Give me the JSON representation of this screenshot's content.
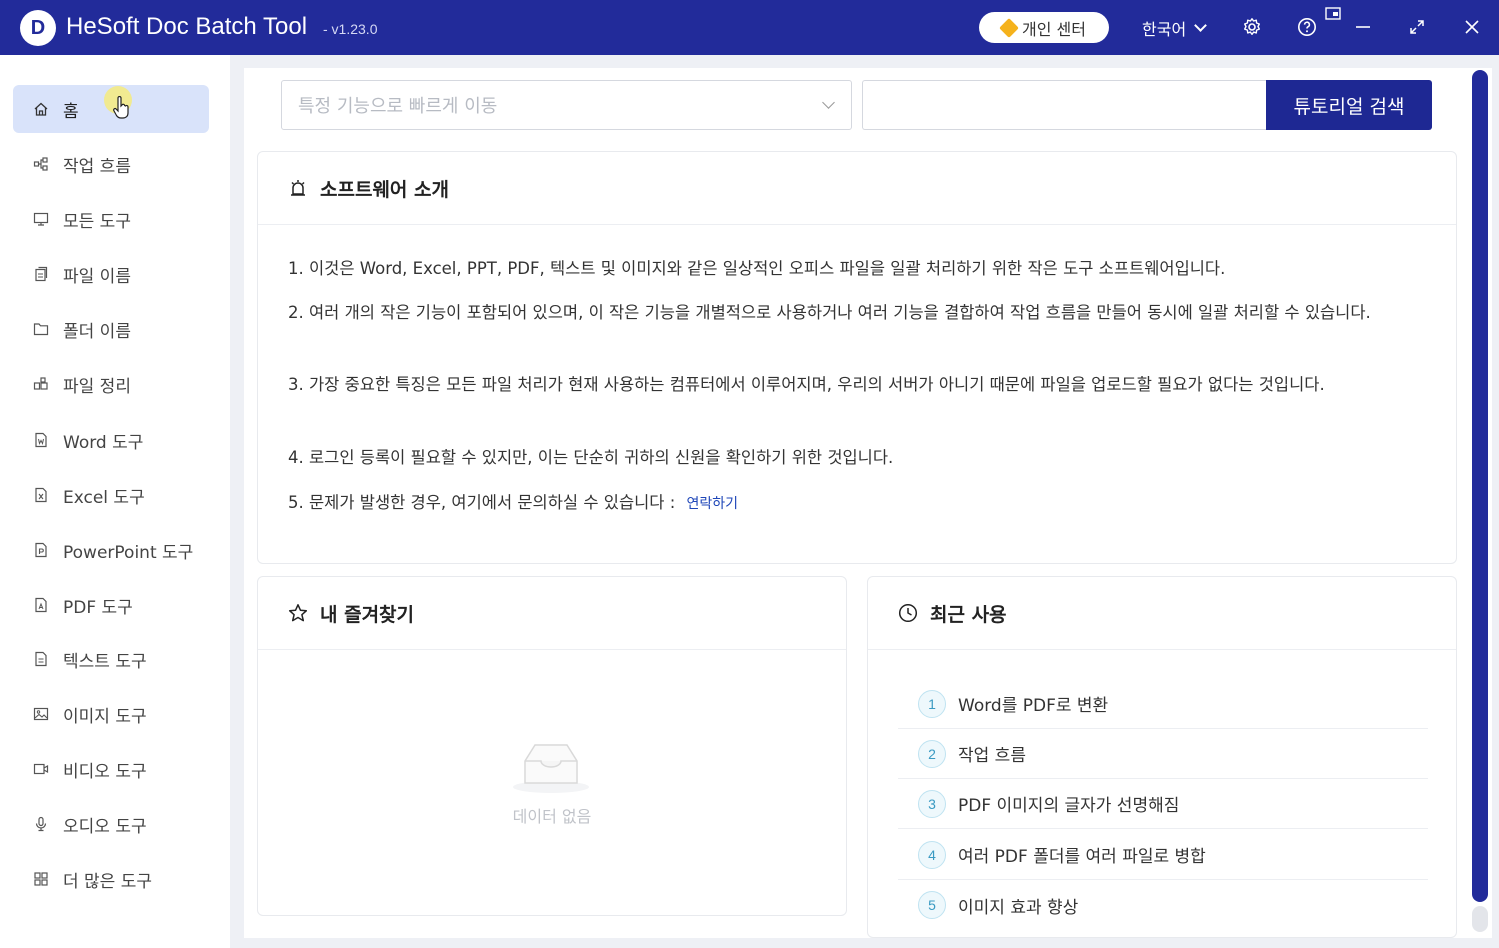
{
  "app": {
    "title": "HeSoft Doc Batch Tool",
    "version": "- v1.23.0",
    "logo_letter": "D"
  },
  "titlebar": {
    "personal_center": "개인 센터",
    "language": "한국어"
  },
  "sidebar": {
    "items": [
      {
        "label": "홈",
        "icon": "home-icon",
        "active": true
      },
      {
        "label": "작업 흐름",
        "icon": "workflow-icon"
      },
      {
        "label": "모든 도구",
        "icon": "monitor-icon"
      },
      {
        "label": "파일 이름",
        "icon": "file-copy-icon"
      },
      {
        "label": "폴더 이름",
        "icon": "folder-icon"
      },
      {
        "label": "파일 정리",
        "icon": "organize-icon"
      },
      {
        "label": "Word 도구",
        "icon": "word-icon"
      },
      {
        "label": "Excel 도구",
        "icon": "excel-icon"
      },
      {
        "label": "PowerPoint 도구",
        "icon": "powerpoint-icon"
      },
      {
        "label": "PDF 도구",
        "icon": "pdf-icon"
      },
      {
        "label": "텍스트 도구",
        "icon": "text-icon"
      },
      {
        "label": "이미지 도구",
        "icon": "image-icon"
      },
      {
        "label": "비디오 도구",
        "icon": "video-icon"
      },
      {
        "label": "오디오 도구",
        "icon": "audio-icon"
      },
      {
        "label": "더 많은 도구",
        "icon": "grid-icon"
      }
    ]
  },
  "search": {
    "select_placeholder": "특정 기능으로 빠르게 이동",
    "input_value": "",
    "button_label": "튜토리얼 검색"
  },
  "intro": {
    "title": "소프트웨어 소개",
    "lines": [
      "1. 이것은 Word, Excel, PPT, PDF, 텍스트 및 이미지와 같은 일상적인 오피스 파일을 일괄 처리하기 위한 작은 도구 소프트웨어입니다.",
      "2. 여러 개의 작은 기능이 포함되어 있으며, 이 작은 기능을 개별적으로 사용하거나 여러 기능을 결합하여 작업 흐름을 만들어 동시에 일괄 처리할 수 있습니다.",
      "3. 가장 중요한 특징은 모든 파일 처리가 현재 사용하는 컴퓨터에서 이루어지며, 우리의 서버가 아니기 때문에 파일을 업로드할 필요가 없다는 것입니다.",
      "4. 로그인 등록이 필요할 수 있지만, 이는 단순히 귀하의 신원을 확인하기 위한 것입니다.",
      "5. 문제가 발생한 경우, 여기에서 문의하실 수 있습니다 :"
    ],
    "contact_link": "연락하기"
  },
  "favorites": {
    "title": "내 즐겨찾기",
    "empty_text": "데이터 없음"
  },
  "recent": {
    "title": "최근 사용",
    "items": [
      {
        "num": "1",
        "label": "Word를 PDF로 변환"
      },
      {
        "num": "2",
        "label": "작업 흐름"
      },
      {
        "num": "3",
        "label": "PDF 이미지의 글자가 선명해짐"
      },
      {
        "num": "4",
        "label": "여러 PDF 폴더를 여러 파일로 병합"
      },
      {
        "num": "5",
        "label": "이미지 효과 향상"
      }
    ]
  },
  "colors": {
    "brand": "#222b9a",
    "active_nav": "#d9e3fa",
    "link": "#1e46b8"
  }
}
